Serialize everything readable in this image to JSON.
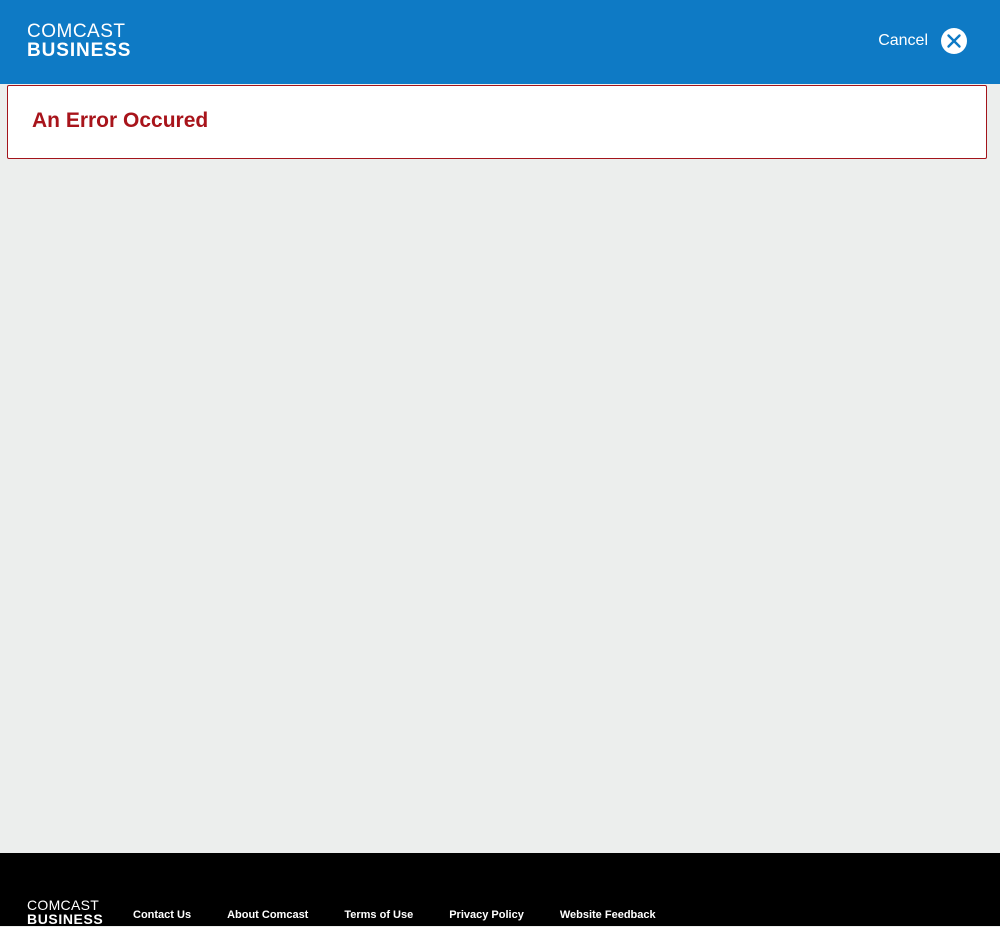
{
  "header": {
    "logo_line1": "COMCAST",
    "logo_line2": "BUSINESS",
    "cancel_label": "Cancel",
    "cancel_icon": "close-circle-icon",
    "background": "#0e7ac5"
  },
  "main": {
    "error_message": "An Error Occured",
    "error_color": "#a8141b",
    "background": "#eceeed"
  },
  "footer": {
    "logo_line1": "COMCAST",
    "logo_line2": "BUSINESS",
    "links": [
      "Contact Us",
      "About Comcast",
      "Terms of Use",
      "Privacy Policy",
      "Website Feedback"
    ],
    "background": "#000000"
  }
}
